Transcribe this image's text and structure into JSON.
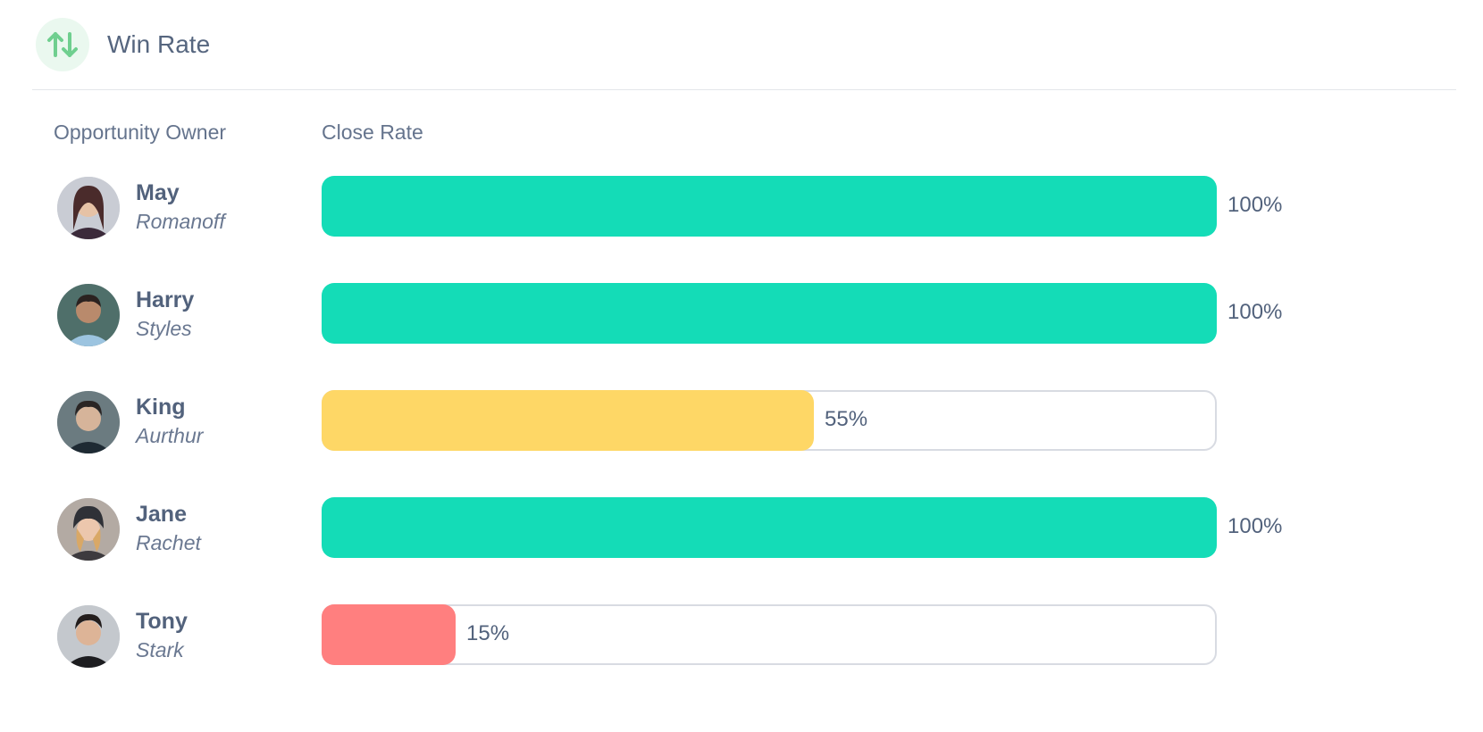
{
  "header": {
    "title": "Win Rate",
    "icon": "sort-arrows-icon",
    "icon_color": "#6fcf8f"
  },
  "columns": {
    "owner": "Opportunity Owner",
    "rate": "Close Rate"
  },
  "colors": {
    "high": "#14dcb7",
    "medium": "#fed766",
    "low": "#ff7f7f"
  },
  "rows": [
    {
      "first": "May",
      "last": "Romanoff",
      "rate": 100,
      "label": "100%",
      "level": "high"
    },
    {
      "first": "Harry",
      "last": "Styles",
      "rate": 100,
      "label": "100%",
      "level": "high"
    },
    {
      "first": "King",
      "last": "Aurthur",
      "rate": 55,
      "label": "55%",
      "level": "medium"
    },
    {
      "first": "Jane",
      "last": "Rachet",
      "rate": 100,
      "label": "100%",
      "level": "high"
    },
    {
      "first": "Tony",
      "last": "Stark",
      "rate": 15,
      "label": "15%",
      "level": "low"
    }
  ]
}
